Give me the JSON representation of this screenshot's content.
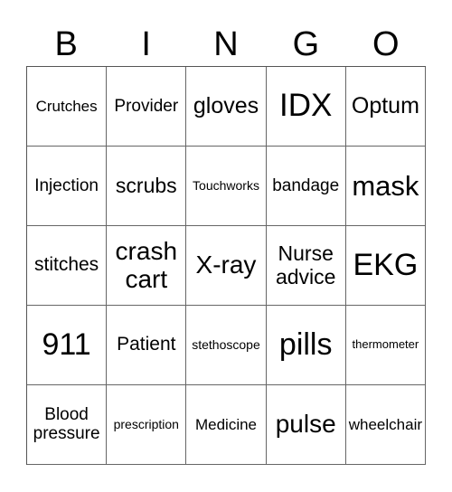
{
  "header": [
    "B",
    "I",
    "N",
    "G",
    "O"
  ],
  "cells": [
    [
      "Crutches",
      "Provider",
      "gloves",
      "IDX",
      "Optum"
    ],
    [
      "Injection",
      "scrubs",
      "Touchworks",
      "bandage",
      "mask"
    ],
    [
      "stitches",
      "crash cart",
      "X-ray",
      "Nurse advice",
      "EKG"
    ],
    [
      "911",
      "Patient",
      "stethoscope",
      "pills",
      "thermometer"
    ],
    [
      "Blood pressure",
      "prescription",
      "Medicine",
      "pulse",
      "wheelchair"
    ]
  ]
}
